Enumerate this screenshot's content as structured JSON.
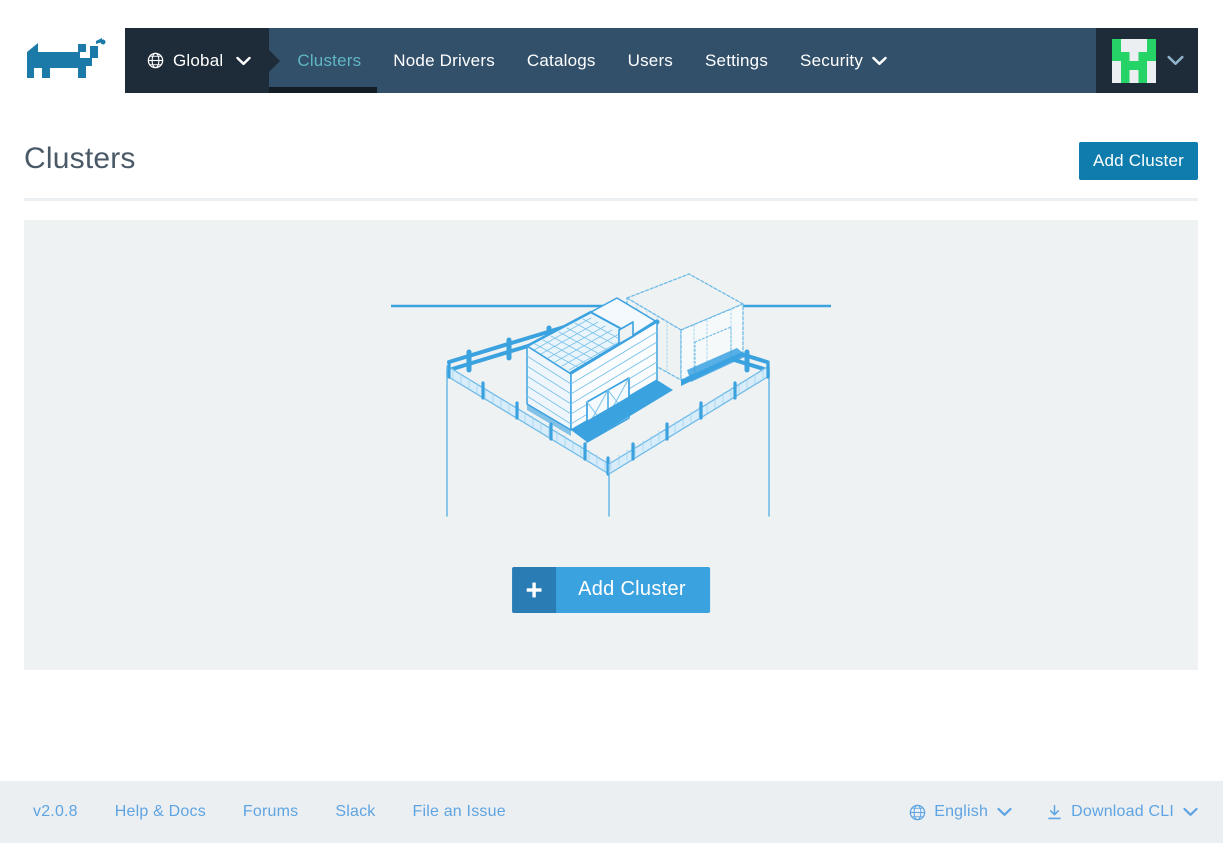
{
  "brand": {
    "logo_icon": "rancher-cow-logo",
    "logo_color": "#1b7aa8"
  },
  "navbar": {
    "scope": {
      "icon": "globe-icon",
      "label": "Global",
      "chevron_icon": "chevron-down-icon"
    },
    "items": [
      {
        "label": "Clusters",
        "active": true,
        "has_chevron": false
      },
      {
        "label": "Node Drivers",
        "active": false,
        "has_chevron": false
      },
      {
        "label": "Catalogs",
        "active": false,
        "has_chevron": false
      },
      {
        "label": "Users",
        "active": false,
        "has_chevron": false
      },
      {
        "label": "Settings",
        "active": false,
        "has_chevron": false
      },
      {
        "label": "Security",
        "active": false,
        "has_chevron": true
      }
    ],
    "user_menu": {
      "avatar_icon": "user-avatar-identicon",
      "avatar_color": "#25d366",
      "chevron_icon": "chevron-down-icon"
    },
    "bg_color": "#33506b",
    "scope_bg_color": "#1e2b38",
    "active_color": "#61b6c4"
  },
  "page": {
    "title": "Clusters",
    "add_cluster_button": "Add Cluster"
  },
  "content": {
    "illustration": "empty-barn-farm-illustration",
    "illustration_color": "#3ba2e0",
    "empty_action": {
      "plus_icon": "plus-icon",
      "label": "Add Cluster"
    },
    "bg_color": "#eff2f3"
  },
  "footer": {
    "links": [
      {
        "label": "v2.0.8"
      },
      {
        "label": "Help & Docs"
      },
      {
        "label": "Forums"
      },
      {
        "label": "Slack"
      },
      {
        "label": "File an Issue"
      }
    ],
    "language": {
      "icon": "globe-icon",
      "label": "English",
      "chevron_icon": "chevron-down-icon"
    },
    "download_cli": {
      "icon": "download-icon",
      "label": "Download CLI",
      "chevron_icon": "chevron-down-icon"
    },
    "link_color": "#5ea4e3",
    "bg_color": "#eceff1"
  }
}
